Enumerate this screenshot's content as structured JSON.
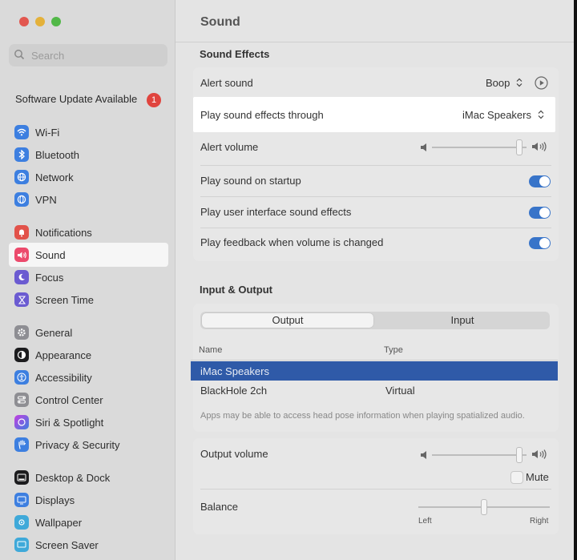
{
  "window": {
    "title": "Sound"
  },
  "sidebar": {
    "search_placeholder": "Search",
    "software_update": {
      "label": "Software Update Available",
      "badge": "1"
    },
    "items": [
      {
        "label": "Wi-Fi",
        "icon": "wifi-icon"
      },
      {
        "label": "Bluetooth",
        "icon": "bluetooth-icon"
      },
      {
        "label": "Network",
        "icon": "network-icon"
      },
      {
        "label": "VPN",
        "icon": "vpn-icon"
      },
      {
        "label": "Notifications",
        "icon": "bell-icon"
      },
      {
        "label": "Sound",
        "icon": "speaker-icon",
        "active": true
      },
      {
        "label": "Focus",
        "icon": "moon-icon"
      },
      {
        "label": "Screen Time",
        "icon": "hourglass-icon"
      },
      {
        "label": "General",
        "icon": "gear-icon"
      },
      {
        "label": "Appearance",
        "icon": "appearance-icon"
      },
      {
        "label": "Accessibility",
        "icon": "accessibility-icon"
      },
      {
        "label": "Control Center",
        "icon": "control-center-icon"
      },
      {
        "label": "Siri & Spotlight",
        "icon": "siri-icon"
      },
      {
        "label": "Privacy & Security",
        "icon": "hand-icon"
      },
      {
        "label": "Desktop & Dock",
        "icon": "dock-icon"
      },
      {
        "label": "Displays",
        "icon": "display-icon"
      },
      {
        "label": "Wallpaper",
        "icon": "wallpaper-icon"
      },
      {
        "label": "Screen Saver",
        "icon": "screensaver-icon"
      }
    ]
  },
  "sound_effects": {
    "section_title": "Sound Effects",
    "alert_sound": {
      "label": "Alert sound",
      "value": "Boop"
    },
    "play_through": {
      "label": "Play sound effects through",
      "value": "iMac Speakers"
    },
    "alert_volume": {
      "label": "Alert volume",
      "level": 0.92
    },
    "startup": {
      "label": "Play sound on startup",
      "on": true
    },
    "ui_effects": {
      "label": "Play user interface sound effects",
      "on": true
    },
    "feedback": {
      "label": "Play feedback when volume is changed",
      "on": true
    }
  },
  "input_output": {
    "section_title": "Input & Output",
    "tabs": [
      "Output",
      "Input"
    ],
    "active_tab": "Output",
    "columns": [
      "Name",
      "Type"
    ],
    "rows": [
      {
        "name": "iMac Speakers",
        "type": "",
        "selected": true
      },
      {
        "name": "BlackHole 2ch",
        "type": "Virtual",
        "selected": false
      }
    ],
    "note": "Apps may be able to access head pose information when playing spatialized audio."
  },
  "output": {
    "volume_label": "Output volume",
    "volume_level": 0.92,
    "mute_label": "Mute",
    "balance_label": "Balance",
    "balance_level": 0.5,
    "balance_left": "Left",
    "balance_right": "Right"
  },
  "colors": {
    "accent": "#3874c9",
    "selection": "#2f5aa8",
    "badge": "#e0443e"
  }
}
